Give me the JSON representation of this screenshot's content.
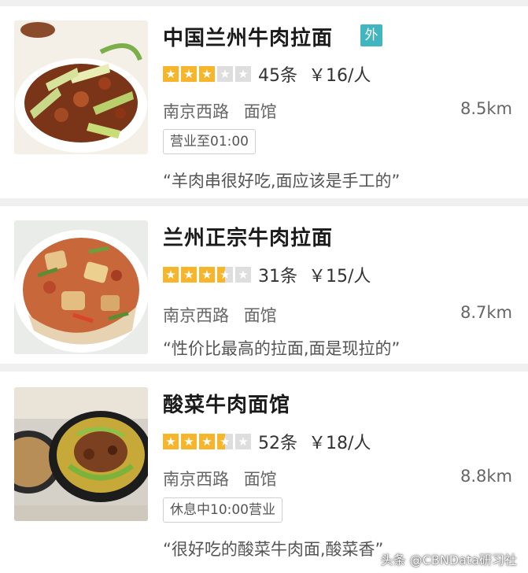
{
  "restaurants": [
    {
      "name": "中国兰州牛肉拉面",
      "delivery_tag": "外",
      "stars": [
        1,
        1,
        1,
        0,
        0
      ],
      "rating": 3,
      "review_count": "45条",
      "price": "￥16/人",
      "area": "南京西路",
      "category": "面馆",
      "distance": "8.5km",
      "hours_badge": "营业至01:00",
      "quote": "“羊肉串很好吃,面应该是手工的”",
      "thumb_icon": "stir-fried-beef-dish-photo"
    },
    {
      "name": "兰州正宗牛肉拉面",
      "stars": [
        1,
        1,
        1,
        0.5,
        0
      ],
      "rating": 3.5,
      "review_count": "31条",
      "price": "￥15/人",
      "area": "南京西路",
      "category": "面馆",
      "distance": "8.7km",
      "quote": "“性价比最高的拉面,面是现拉的”",
      "thumb_icon": "chicken-noodle-dish-photo"
    },
    {
      "name": "酸菜牛肉面馆",
      "stars": [
        1,
        1,
        1,
        0.5,
        0
      ],
      "rating": 3.5,
      "review_count": "52条",
      "price": "￥18/人",
      "area": "南京西路",
      "category": "面馆",
      "distance": "8.8km",
      "hours_badge": "休息中10:00营业",
      "quote": "“很好吃的酸菜牛肉面,酸菜香”",
      "thumb_icon": "pickled-cabbage-beef-noodle-photo"
    }
  ],
  "watermark": "头条 @CBNData研习社",
  "colors": {
    "star_fill": "#f7b52c",
    "star_empty": "#dedede",
    "delivery_tag_bg": "#41b6c0"
  }
}
